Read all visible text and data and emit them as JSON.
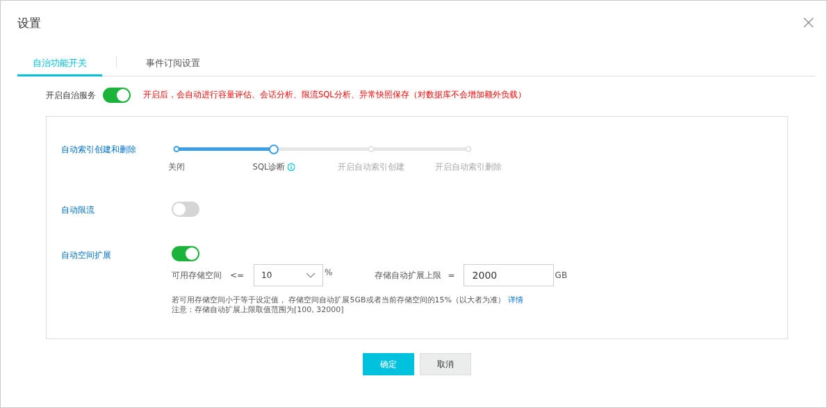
{
  "dialog": {
    "title": "设置"
  },
  "tabs": [
    {
      "label": "自治功能开关",
      "selected": true
    },
    {
      "label": "事件订阅设置",
      "selected": false
    }
  ],
  "service": {
    "label": "开启自治服务",
    "on": true,
    "note": "开启后，会自动进行容量评估、会话分析、限流SQL分析、异常快照保存（对数据库不会增加额外负载）"
  },
  "index_setting": {
    "label": "自动索引创建和删除",
    "level": 0.333,
    "steps": [
      {
        "label": "关闭",
        "kind": "plain"
      },
      {
        "label": "SQL诊断",
        "kind": "info"
      },
      {
        "label": "开启自动索引创建",
        "kind": "plain"
      },
      {
        "label": "开启自动索引删除",
        "kind": "plain"
      }
    ]
  },
  "throttle": {
    "label": "自动限流",
    "on": false
  },
  "expansion": {
    "label": "自动空间扩展",
    "on": true,
    "free_space_label": "可用存储空间",
    "free_space_op": "<=",
    "free_space_value": "10",
    "free_space_unit": "%",
    "limit_label": "存储自动扩展上限",
    "limit_op": "=",
    "limit_value": "2000",
    "limit_unit": "GB",
    "help": "若可用存储空间小于等于设定值， 存储空间自动扩展5GB或者当前存储空间的15%（以大者为准）",
    "help_link": "详情",
    "note": "注意：存储自动扩展上限取值范围为[100, 32000]"
  },
  "buttons": [
    {
      "label": "确定",
      "kind": "primary"
    },
    {
      "label": "取消",
      "kind": "secondary"
    }
  ]
}
